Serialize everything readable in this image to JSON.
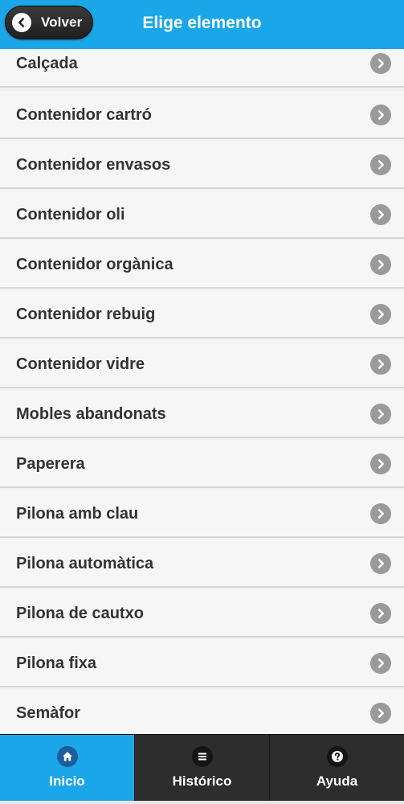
{
  "header": {
    "back_label": "Volver",
    "title": "Elige elemento"
  },
  "list": {
    "items": [
      {
        "label": "Calçada"
      },
      {
        "label": "Contenidor cartró"
      },
      {
        "label": "Contenidor envasos"
      },
      {
        "label": "Contenidor oli"
      },
      {
        "label": "Contenidor orgànica"
      },
      {
        "label": "Contenidor rebuig"
      },
      {
        "label": "Contenidor vidre"
      },
      {
        "label": "Mobles abandonats"
      },
      {
        "label": "Paperera"
      },
      {
        "label": "Pilona amb clau"
      },
      {
        "label": "Pilona automàtica"
      },
      {
        "label": "Pilona de cautxo"
      },
      {
        "label": "Pilona fixa"
      },
      {
        "label": "Semàfor"
      }
    ]
  },
  "nav": {
    "tabs": [
      {
        "label": "Inicio",
        "icon": "home-icon",
        "active": true
      },
      {
        "label": "Histórico",
        "icon": "menu-icon",
        "active": false
      },
      {
        "label": "Ayuda",
        "icon": "help-icon",
        "active": false
      }
    ]
  },
  "colors": {
    "accent": "#1aa6e8",
    "header_text": "#ffffff",
    "item_text": "#333333",
    "chevron": "#9a9a9a",
    "nav_background": "#2d2d2d"
  }
}
